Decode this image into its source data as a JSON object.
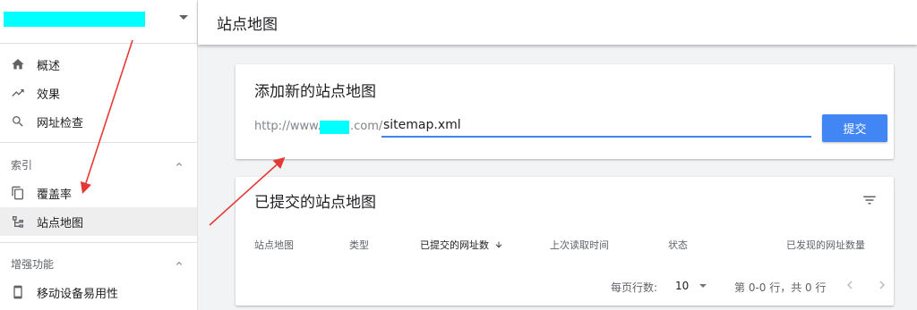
{
  "sidebar": {
    "mask_color": "#00ffff",
    "top_items": [
      {
        "label": "概述",
        "icon": "home-icon"
      },
      {
        "label": "效果",
        "icon": "trending-up-icon"
      },
      {
        "label": "网址检查",
        "icon": "search-icon"
      }
    ],
    "index_section": {
      "title": "索引",
      "items": [
        {
          "label": "覆盖率",
          "icon": "copy-pages-icon"
        },
        {
          "label": "站点地图",
          "icon": "sitemap-icon",
          "active": true
        }
      ]
    },
    "enhancements_section": {
      "title": "增强功能",
      "items": [
        {
          "label": "移动设备易用性",
          "icon": "smartphone-icon"
        }
      ]
    }
  },
  "header": {
    "title": "站点地图"
  },
  "add_sitemap": {
    "title": "添加新的站点地图",
    "url_prefix": "http://www.",
    "url_suffix": ".com/",
    "input_value": "sitemap.xml",
    "submit_label": "提交"
  },
  "submitted": {
    "title": "已提交的站点地图",
    "columns": [
      "站点地图",
      "类型",
      "已提交的网址数",
      "上次读取时间",
      "状态",
      "已发现的网址数量"
    ],
    "rows_per_page_label": "每页行数:",
    "rows_per_page_value": "10",
    "range_text": "第 0-0 行，共 0 行"
  },
  "colors": {
    "accent": "#4285f4",
    "annotation_arrow": "#e53935"
  }
}
